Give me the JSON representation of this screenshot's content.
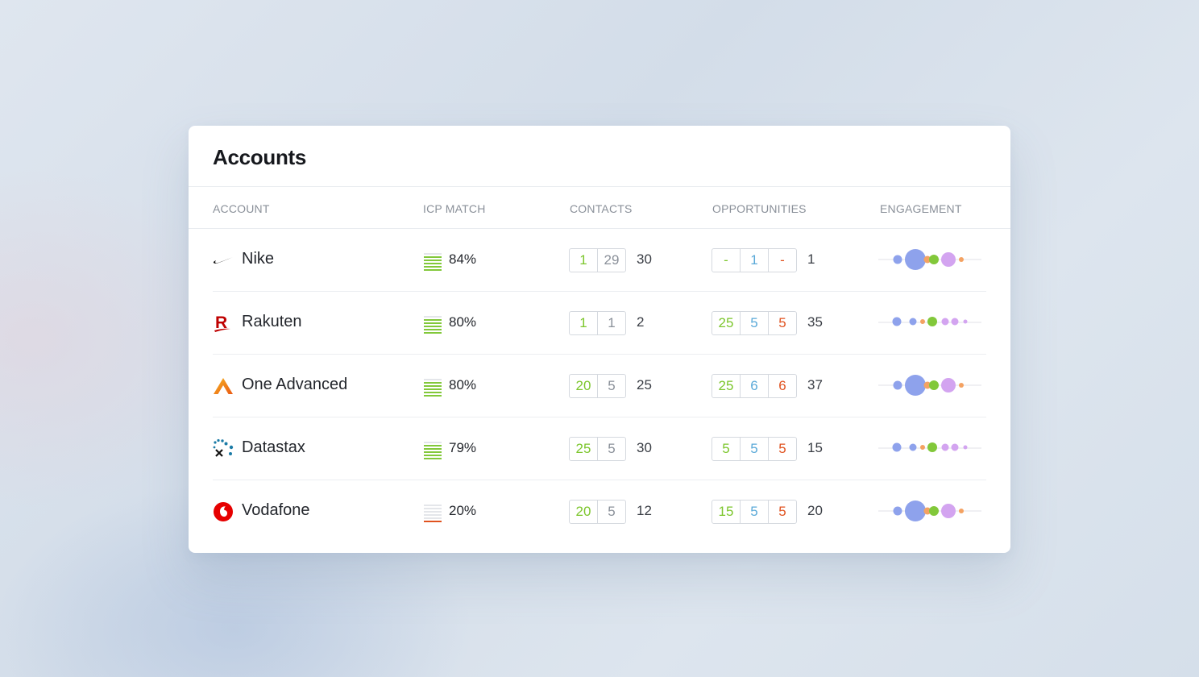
{
  "title": "Accounts",
  "columns": {
    "account": "ACCOUNT",
    "icp": "ICP MATCH",
    "contacts": "CONTACTS",
    "opportunities": "OPPORTUNITIES",
    "engagement": "ENGAGEMENT"
  },
  "colors": {
    "green": "#7cc62c",
    "gray": "#8a9099",
    "blue": "#5aa9d8",
    "red": "#e0521f",
    "eng_blue": "#8ea2ec",
    "eng_green": "#82c83a",
    "eng_orange": "#f4a262",
    "eng_purple": "#d3a4f0"
  },
  "rows": [
    {
      "name": "Nike",
      "logo": "nike-swoosh-icon",
      "icp": "84%",
      "icp_level": 0.84,
      "contacts": [
        "1",
        "29"
      ],
      "contacts_total": "30",
      "opps": [
        "-",
        "1",
        "-"
      ],
      "opps_total": "1",
      "engagement_style": "large"
    },
    {
      "name": "Rakuten",
      "logo": "rakuten-r-icon",
      "icp": "80%",
      "icp_level": 0.8,
      "contacts": [
        "1",
        "1"
      ],
      "contacts_total": "2",
      "opps": [
        "25",
        "5",
        "5"
      ],
      "opps_total": "35",
      "engagement_style": "small"
    },
    {
      "name": "One Advanced",
      "logo": "one-advanced-icon",
      "icp": "80%",
      "icp_level": 0.8,
      "contacts": [
        "20",
        "5"
      ],
      "contacts_total": "25",
      "opps": [
        "25",
        "6",
        "6"
      ],
      "opps_total": "37",
      "engagement_style": "large"
    },
    {
      "name": "Datastax",
      "logo": "datastax-icon",
      "icp": "79%",
      "icp_level": 0.79,
      "contacts": [
        "25",
        "5"
      ],
      "contacts_total": "30",
      "opps": [
        "5",
        "5",
        "5"
      ],
      "opps_total": "15",
      "engagement_style": "small"
    },
    {
      "name": "Vodafone",
      "logo": "vodafone-icon",
      "icp": "20%",
      "icp_level": 0.2,
      "contacts": [
        "20",
        "5"
      ],
      "contacts_total": "12",
      "opps": [
        "15",
        "5",
        "5"
      ],
      "opps_total": "20",
      "engagement_style": "large"
    }
  ]
}
